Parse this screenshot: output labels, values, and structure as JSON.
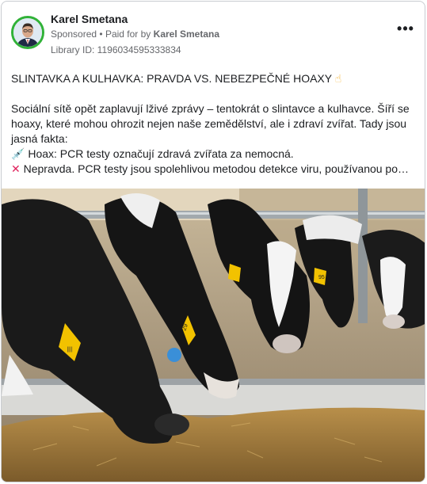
{
  "post": {
    "author": "Karel Smetana",
    "sponsored": "Sponsored",
    "bullet": "•",
    "paid_for_prefix": "Paid for by",
    "paid_for_name": "Karel Smetana",
    "library_id": "Library ID: 1196034595333834",
    "menu_label": "•••",
    "headline": "SLINTAVKA A KULHAVKA: PRAVDA VS. NEBEZPEČNÉ HOAXY",
    "headline_emoji": "☝",
    "paragraph": "Sociální sítě opět zaplavují lživé zprávy – tentokrát o slintavce a kulhavce. Šíří se hoaxy, které mohou ohrozit nejen naše zemědělství, ale i zdraví zvířat. Tady jsou jasná fakta:",
    "hoax_icon": "💉",
    "hoax_text": "Hoax: PCR testy označují zdravá zvířata za nemocná.",
    "truth_icon": "✕",
    "truth_text": "Nepravda. PCR testy jsou spolehlivou metodou detekce viru, používanou po…"
  },
  "photo": {
    "subject": "cows-eating-hay-in-barn",
    "ear_tag_numbers": [
      "29",
      "95"
    ]
  },
  "colors": {
    "avatar_ring": "#31b238",
    "secondary_text": "#65676b",
    "tag_yellow": "#f2c200",
    "tag_blue": "#3a8fd8"
  }
}
